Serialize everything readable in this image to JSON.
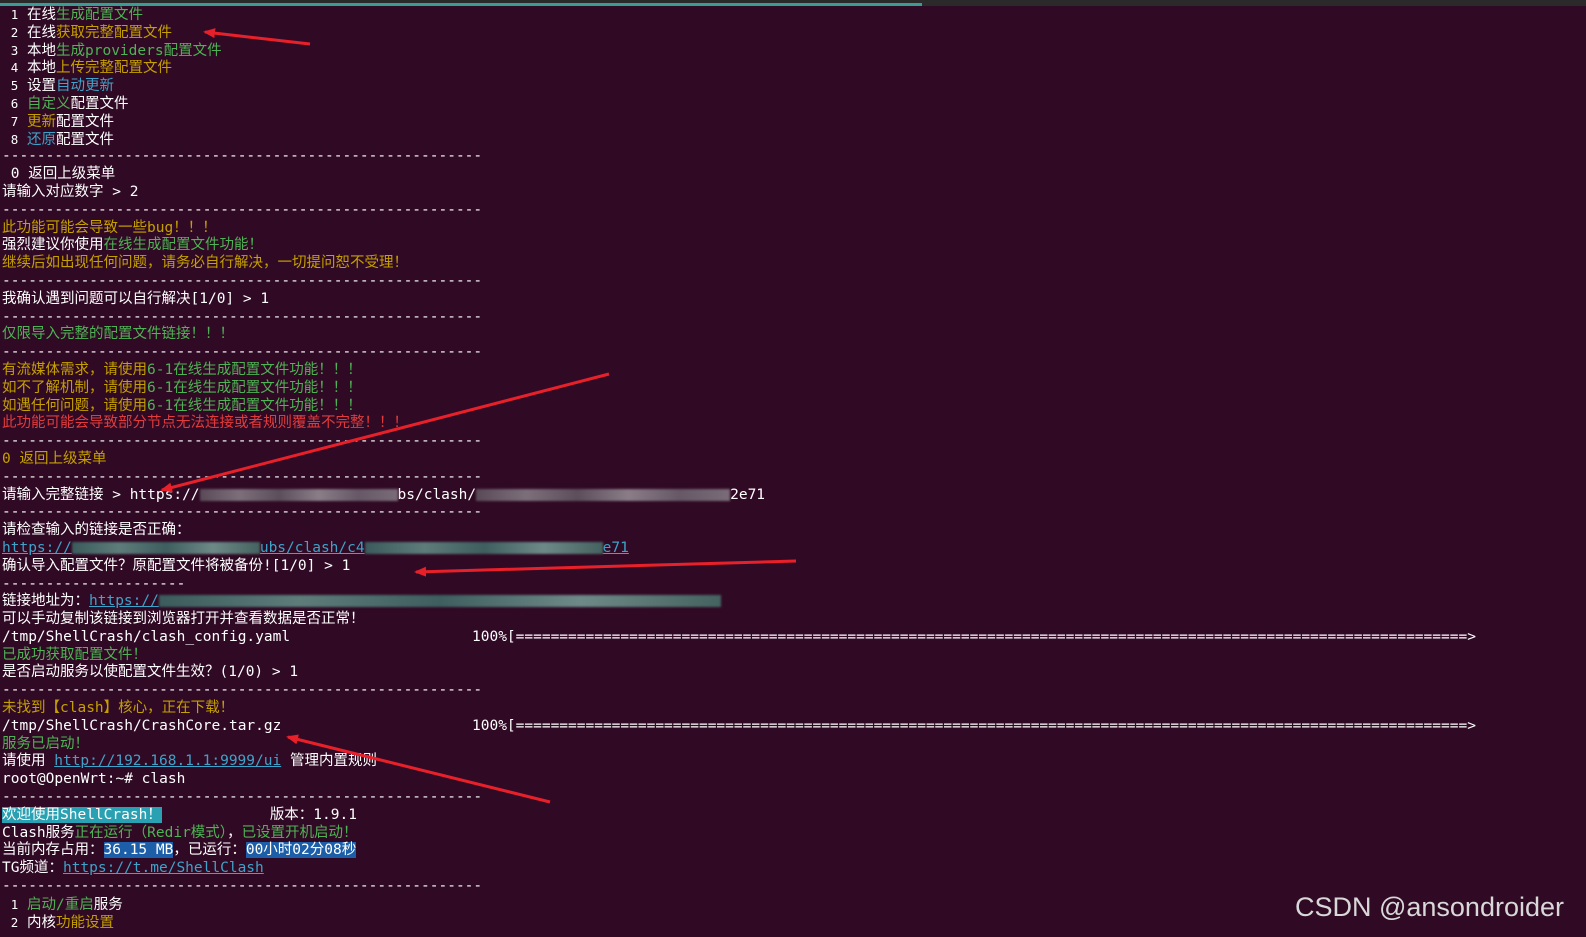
{
  "menu": [
    {
      "num": "1",
      "parts": [
        {
          "t": "在线",
          "c": "w"
        },
        {
          "t": "生成配置文件",
          "c": "g"
        }
      ]
    },
    {
      "num": "2",
      "parts": [
        {
          "t": "在线",
          "c": "w"
        },
        {
          "t": "获取完整配置文件",
          "c": "o"
        }
      ]
    },
    {
      "num": "3",
      "parts": [
        {
          "t": "本地",
          "c": "w"
        },
        {
          "t": "生成providers配置文件",
          "c": "g"
        }
      ]
    },
    {
      "num": "4",
      "parts": [
        {
          "t": "本地",
          "c": "w"
        },
        {
          "t": "上传完整配置文件",
          "c": "o"
        }
      ]
    },
    {
      "num": "5",
      "parts": [
        {
          "t": "设置",
          "c": "w"
        },
        {
          "t": "自动更新",
          "c": "c"
        }
      ]
    },
    {
      "num": "6",
      "parts": [
        {
          "t": "自定义",
          "c": "g"
        },
        {
          "t": "配置文件",
          "c": "w"
        }
      ]
    },
    {
      "num": "7",
      "parts": [
        {
          "t": "更新",
          "c": "o"
        },
        {
          "t": "配置文件",
          "c": "w"
        }
      ]
    },
    {
      "num": "8",
      "parts": [
        {
          "t": "还原",
          "c": "c"
        },
        {
          "t": "配置文件",
          "c": "w"
        }
      ]
    }
  ],
  "separator": "-------------------------------------------------------",
  "back_menu": "0 返回上级菜单",
  "prompt_choice": "请输入对应数字 > 2",
  "warn1": "此功能可能会导致一些bug！！！",
  "warn2_pre": "强烈建议你使用",
  "warn2_link": "在线生成配置文件功能！",
  "warn3": "继续后如出现任何问题，请务必自行解决，一切提问恕不受理！",
  "confirm_self": "我确认遇到问题可以自行解决[1/0] > 1",
  "only_full": "仅限导入完整的配置文件链接！！！",
  "tips": [
    {
      "pre": "有流媒体需求，请使用",
      "post": "6-1在线生成配置文件功能！！！"
    },
    {
      "pre": "如不了解机制，请使用",
      "post": "6-1在线生成配置文件功能！！！"
    },
    {
      "pre": "如遇任何问题，请使用",
      "post": "6-1在线生成配置文件功能！！！"
    }
  ],
  "warn_red": "此功能可能会导致部分节点无法连接或者规则覆盖不完整！！！",
  "back_yellow": "0 返回上级菜单",
  "input_link_pre": "请输入完整链接 > https://",
  "input_link_mid": "bs/clash/",
  "input_link_end": "2e71",
  "check_link": "请检查输入的链接是否正确：",
  "check_url_pre": "https://",
  "check_url_mid": "ubs/clash/c4",
  "check_url_end": "e71",
  "confirm_import": "确认导入配置文件？原配置文件将被备份![1/0] > 1",
  "link_addr_pre": "链接地址为：",
  "link_addr_url": "https://",
  "manual_copy": "可以手动复制该链接到浏览器打开并查看数据是否正常！",
  "download1_file": "/tmp/ShellCrash/clash_config.yaml",
  "download_bar": "100%[=============================================================================================================>",
  "got_config": "已成功获取配置文件！",
  "start_service": "是否启动服务以使配置文件生效？(1/0) > 1",
  "core_missing": "未找到【clash】核心，正在下载！",
  "download2_file": "/tmp/ShellCrash/CrashCore.tar.gz",
  "service_started": "服务已启动！",
  "use_pre": "请使用 ",
  "use_url": "http://192.168.1.1:9999/ui",
  "use_post": " 管理内置规则",
  "shell_prompt": "root@OpenWrt:~# clash",
  "welcome": "欢迎使用ShellCrash！",
  "version": "版本：1.9.1",
  "service_pre": "Clash服务",
  "service_running": "正在运行（Redir模式）",
  "service_sep": "，",
  "autostart": "已设置开机启动！",
  "mem_pre": "当前内存占用：",
  "mem_val": "36.15 MB",
  "run_pre": "，已运行：",
  "run_val": "00小时02分08秒",
  "tg_pre": "TG频道：",
  "tg_url": "https://t.me/ShellClash",
  "bottom_menu": [
    {
      "num": "1",
      "parts": [
        {
          "t": "启动/重启",
          "c": "g"
        },
        {
          "t": "服务",
          "c": "w"
        }
      ]
    },
    {
      "num": "2",
      "parts": [
        {
          "t": "内核",
          "c": "w"
        },
        {
          "t": "功能设置",
          "c": "o"
        }
      ]
    }
  ],
  "watermark": "CSDN @ansondroider",
  "colors": {
    "background": "#300a24",
    "green": "#4eb354",
    "yellow": "#c4a000",
    "cyan": "#3fa3c9",
    "red": "#e23b3b",
    "arrow": "#e8202a"
  }
}
